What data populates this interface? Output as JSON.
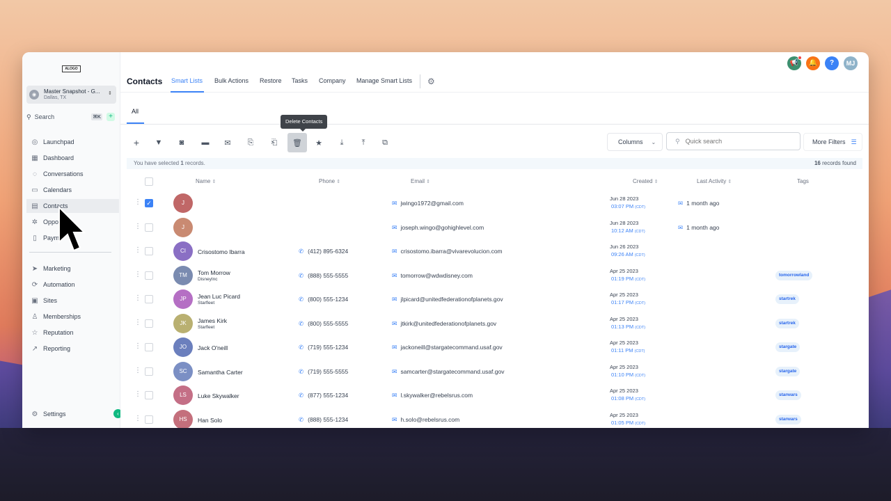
{
  "colors": {
    "accent": "#3b82f6",
    "brand_green": "#10b981"
  },
  "sidebar": {
    "logo": "ALOGO",
    "account": {
      "name": "Master Snapshot - G...",
      "location": "Dallas, TX"
    },
    "search": {
      "label": "Search",
      "shortcut": "⌘K"
    },
    "items_top": [
      {
        "label": "Launchpad",
        "icon": "rocket-icon"
      },
      {
        "label": "Dashboard",
        "icon": "grid-icon"
      },
      {
        "label": "Conversations",
        "icon": "chat-icon"
      },
      {
        "label": "Calendars",
        "icon": "calendar-icon"
      },
      {
        "label": "Contacts",
        "icon": "contacts-icon"
      },
      {
        "label": "Oppo",
        "icon": "opportunities-icon"
      },
      {
        "label": "Paym",
        "icon": "payments-icon"
      }
    ],
    "items_bottom": [
      {
        "label": "Marketing",
        "icon": "send-icon"
      },
      {
        "label": "Automation",
        "icon": "automation-icon"
      },
      {
        "label": "Sites",
        "icon": "sites-icon"
      },
      {
        "label": "Memberships",
        "icon": "memberships-icon"
      },
      {
        "label": "Reputation",
        "icon": "star-icon"
      },
      {
        "label": "Reporting",
        "icon": "chart-icon"
      }
    ],
    "settings": "Settings"
  },
  "header": {
    "title": "Contacts",
    "tabs": [
      "Smart Lists",
      "Bulk Actions",
      "Restore",
      "Tasks",
      "Company",
      "Manage Smart Lists"
    ],
    "user_initials": "MJ"
  },
  "content": {
    "subtab": "All",
    "tooltip": "Delete Contacts",
    "columns_label": "Columns",
    "search_placeholder": "Quick search",
    "more_filters": "More Filters",
    "selected_prefix": "You have selected ",
    "selected_count": "1",
    "selected_suffix": " records.",
    "records_found_count": "16",
    "records_found_suffix": " records found",
    "columns": [
      "Name",
      "Phone",
      "Email",
      "Created",
      "Last Activity",
      "Tags"
    ]
  },
  "contacts": [
    {
      "initials": "J",
      "name": "",
      "company": "",
      "phone": "",
      "email": "jwingo1972@gmail.com",
      "date": "Jun 28 2023",
      "time": "03:07 PM",
      "tz": "(CDT)",
      "activity": "1 month ago",
      "tag": "",
      "color": "#c06767",
      "checked": true
    },
    {
      "initials": "J",
      "name": "",
      "company": "",
      "phone": "",
      "email": "joseph.wingo@gohighlevel.com",
      "date": "Jun 28 2023",
      "time": "10:12 AM",
      "tz": "(CDT)",
      "activity": "1 month ago",
      "tag": "",
      "color": "#c98a72",
      "checked": false
    },
    {
      "initials": "CI",
      "name": "Crisostomo Ibarra",
      "company": "",
      "phone": "(412) 895-6324",
      "email": "crisostomo.ibarra@vivarevolucion.com",
      "date": "Jun 26 2023",
      "time": "09:26 AM",
      "tz": "(CDT)",
      "activity": "",
      "tag": "",
      "color": "#8a6fc4",
      "checked": false
    },
    {
      "initials": "TM",
      "name": "Tom Morrow",
      "company": "DisneyInc",
      "phone": "(888) 555-5555",
      "email": "tomorrow@wdwdisney.com",
      "date": "Apr 25 2023",
      "time": "01:19 PM",
      "tz": "(CDT)",
      "activity": "",
      "tag": "tomorrowland",
      "color": "#7a8bb0",
      "checked": false
    },
    {
      "initials": "JP",
      "name": "Jean Luc Picard",
      "company": "Starfleet",
      "phone": "(800) 555-1234",
      "email": "jlpicard@unitedfederationofplanets.gov",
      "date": "Apr 25 2023",
      "time": "01:17 PM",
      "tz": "(CDT)",
      "activity": "",
      "tag": "startrek",
      "color": "#b56fc4",
      "checked": false
    },
    {
      "initials": "JK",
      "name": "James Kirk",
      "company": "Starfleet",
      "phone": "(800) 555-5555",
      "email": "jtkirk@unitedfederationofplanets.gov",
      "date": "Apr 25 2023",
      "time": "01:13 PM",
      "tz": "(CDT)",
      "activity": "",
      "tag": "startrek",
      "color": "#b9b071",
      "checked": false
    },
    {
      "initials": "JO",
      "name": "Jack O'neill",
      "company": "",
      "phone": "(719) 555-1234",
      "email": "jackoneill@stargatecommand.usaf.gov",
      "date": "Apr 25 2023",
      "time": "01:11 PM",
      "tz": "(CDT)",
      "activity": "",
      "tag": "stargate",
      "color": "#6b7fbd",
      "checked": false
    },
    {
      "initials": "SC",
      "name": "Samantha Carter",
      "company": "",
      "phone": "(719) 555-5555",
      "email": "samcarter@stargatecommand.usaf.gov",
      "date": "Apr 25 2023",
      "time": "01:10 PM",
      "tz": "(CDT)",
      "activity": "",
      "tag": "stargate",
      "color": "#7b8fc4",
      "checked": false
    },
    {
      "initials": "LS",
      "name": "Luke Skywalker",
      "company": "",
      "phone": "(877) 555-1234",
      "email": "l.skywalker@rebelsrus.com",
      "date": "Apr 25 2023",
      "time": "01:08 PM",
      "tz": "(CDT)",
      "activity": "",
      "tag": "starwars",
      "color": "#c46f86",
      "checked": false
    },
    {
      "initials": "HS",
      "name": "Han Solo",
      "company": "",
      "phone": "(888) 555-1234",
      "email": "h.solo@rebelsrus.com",
      "date": "Apr 25 2023",
      "time": "01:05 PM",
      "tz": "(CDT)",
      "activity": "",
      "tag": "starwars",
      "color": "#c46f7c",
      "checked": false
    }
  ]
}
